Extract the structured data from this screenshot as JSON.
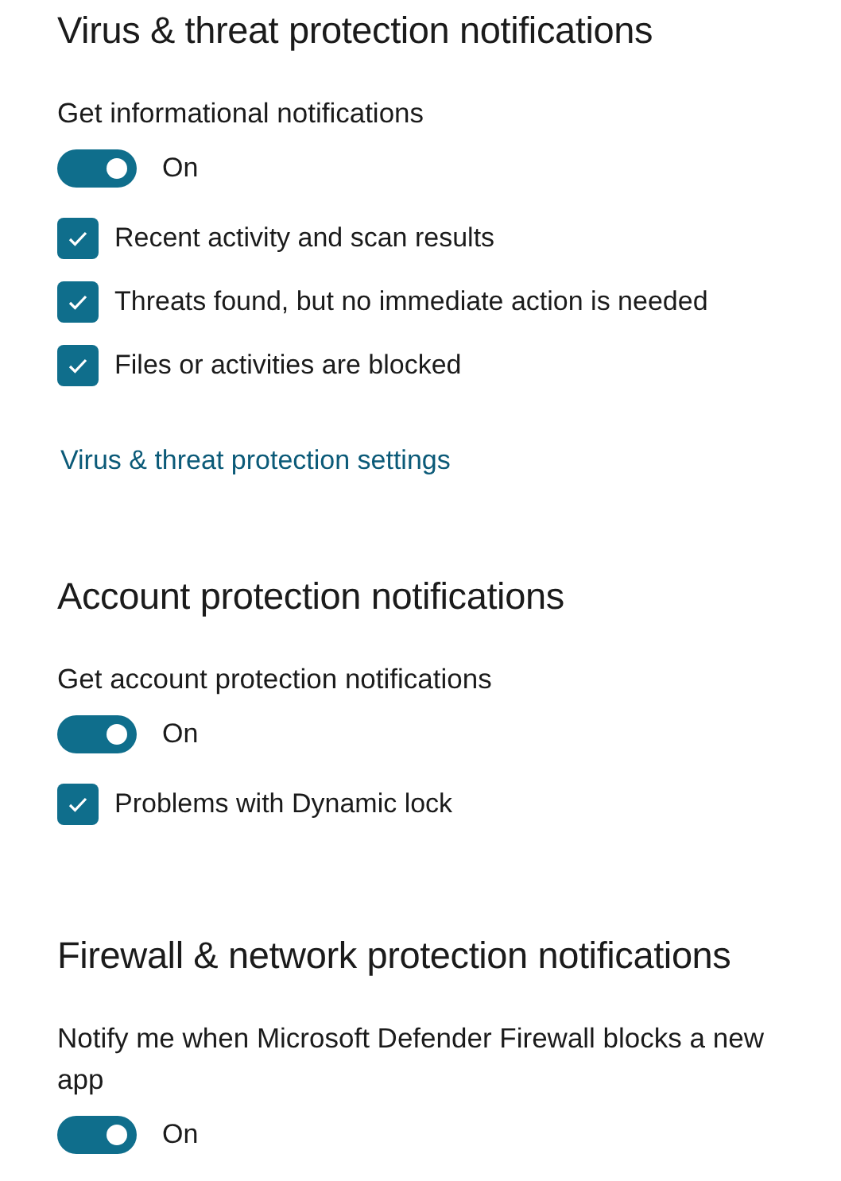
{
  "sections": [
    {
      "title": "Virus & threat protection notifications",
      "description": "Get informational notifications",
      "toggle": {
        "on": true,
        "label": "On"
      },
      "options": [
        {
          "label": "Recent activity and scan results",
          "checked": true
        },
        {
          "label": "Threats found, but no immediate action is needed",
          "checked": true
        },
        {
          "label": "Files or activities are blocked",
          "checked": true
        }
      ],
      "link": "Virus & threat protection settings"
    },
    {
      "title": "Account protection notifications",
      "description": "Get account protection notifications",
      "toggle": {
        "on": true,
        "label": "On"
      },
      "options": [
        {
          "label": "Problems with Dynamic lock",
          "checked": true
        }
      ]
    },
    {
      "title": "Firewall & network protection notifications",
      "description": "Notify me when Microsoft Defender Firewall blocks a new app",
      "toggle": {
        "on": true,
        "label": "On"
      }
    }
  ]
}
